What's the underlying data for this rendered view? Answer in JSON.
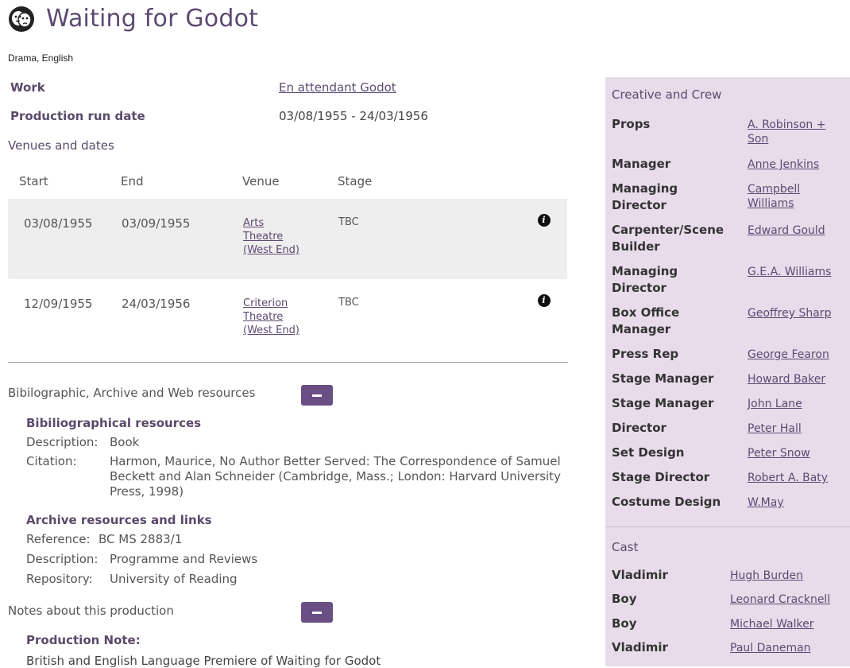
{
  "title": "Waiting for Godot",
  "genre": "Drama, English",
  "work": {
    "label": "Work",
    "value": "En attendant Godot"
  },
  "run_date": {
    "label": "Production run date",
    "value": "03/08/1955 - 24/03/1956"
  },
  "venues": {
    "heading": "Venues and dates",
    "columns": [
      "Start",
      "End",
      "Venue",
      "Stage"
    ],
    "rows": [
      {
        "start": "03/08/1955",
        "end": "03/09/1955",
        "venue_lines": [
          "Arts",
          "Theatre",
          "(West End)"
        ],
        "stage": "TBC"
      },
      {
        "start": "12/09/1955",
        "end": "24/03/1956",
        "venue_lines": [
          "Criterion",
          "Theatre",
          "(West End)"
        ],
        "stage": "TBC"
      }
    ]
  },
  "resources": {
    "heading": "Bibilographic, Archive and Web resources",
    "biblio_heading": "Bibiliographical resources",
    "biblio": {
      "description_key": "Description:",
      "description_val": "Book",
      "citation_key": "Citation:",
      "citation_val": "Harmon, Maurice, No Author Better Served: The Correspondence of Samuel Beckett and Alan Schneider (Cambridge, Mass.; London: Harvard University Press, 1998)"
    },
    "archive_heading": "Archive resources and links",
    "archive": {
      "reference_key": "Reference:",
      "reference_val": "BC MS 2883/1",
      "description_key": "Description:",
      "description_val": "Programme and Reviews",
      "repository_key": "Repository:",
      "repository_val": "University of Reading"
    }
  },
  "notes": {
    "heading": "Notes about this production",
    "sub_heading": "Production Note:",
    "text": "British and English Language Premiere of Waiting for Godot"
  },
  "sidebar": {
    "crew_heading": "Creative and Crew",
    "crew": [
      {
        "role": "Props",
        "name": "A. Robinson + Son"
      },
      {
        "role": "Manager",
        "name": "Anne Jenkins"
      },
      {
        "role": "Managing Director",
        "name": "Campbell Williams"
      },
      {
        "role": "Carpenter/Scene Builder",
        "name": "Edward Gould"
      },
      {
        "role": "Managing Director",
        "name": "G.E.A. Williams"
      },
      {
        "role": "Box Office Manager",
        "name": "Geoffrey Sharp"
      },
      {
        "role": "Press Rep",
        "name": "George Fearon"
      },
      {
        "role": "Stage Manager",
        "name": "Howard Baker"
      },
      {
        "role": "Stage Manager",
        "name": "John Lane"
      },
      {
        "role": "Director",
        "name": "Peter Hall"
      },
      {
        "role": "Set Design",
        "name": "Peter Snow"
      },
      {
        "role": "Stage Director",
        "name": "Robert A. Baty"
      },
      {
        "role": "Costume Design",
        "name": "W.May"
      }
    ],
    "cast_heading": "Cast",
    "cast": [
      {
        "role": "Vladimir",
        "name": "Hugh Burden"
      },
      {
        "role": "Boy",
        "name": "Leonard Cracknell"
      },
      {
        "role": "Boy",
        "name": "Michael Walker"
      },
      {
        "role": "Vladimir",
        "name": "Paul Daneman"
      }
    ]
  },
  "colors": {
    "accent": "#5c4a72",
    "button": "#6a4f84",
    "sidebar_bg": "#e8dcea",
    "row_shade": "#eeeeee"
  },
  "icons": {
    "title": "theatre-masks-icon",
    "info": "info-icon",
    "collapse": "minus-icon"
  }
}
